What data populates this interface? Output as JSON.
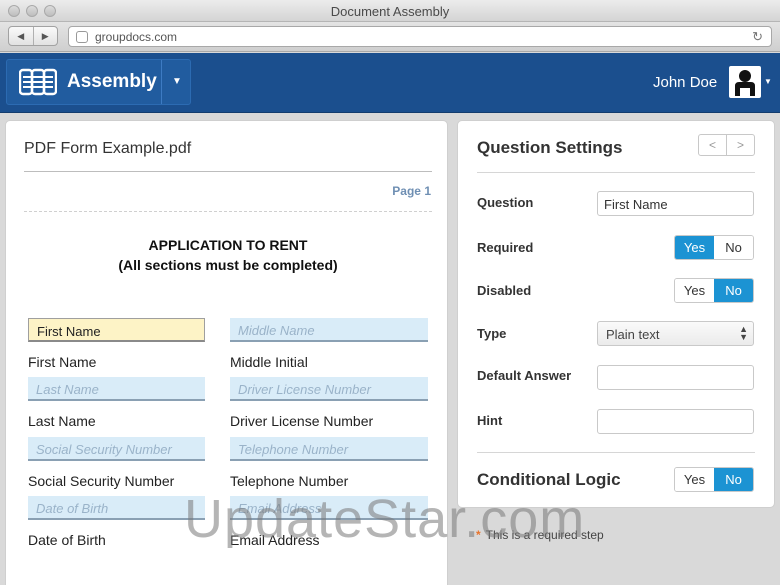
{
  "window": {
    "title": "Document Assembly"
  },
  "browser": {
    "url": "groupdocs.com",
    "back": "◀",
    "forward": "▶",
    "reload": "↻"
  },
  "app": {
    "brand": "Assembly",
    "user_name": "John Doe"
  },
  "document": {
    "file_name": "PDF Form Example.pdf",
    "page_label": "Page 1",
    "heading_line1": "APPLICATION TO RENT",
    "heading_line2": "(All sections must be completed)",
    "rows": [
      {
        "left": {
          "value": "First Name",
          "label": "First Name"
        },
        "right": {
          "placeholder": "Middle Name",
          "label": "Middle Initial"
        }
      },
      {
        "left": {
          "placeholder": "Last Name",
          "label": "Last Name"
        },
        "right": {
          "placeholder": "Driver License Number",
          "label": "Driver License Number"
        }
      },
      {
        "left": {
          "placeholder": "Social Security Number",
          "label": "Social Security Number"
        },
        "right": {
          "placeholder": "Telephone Number",
          "label": "Telephone Number"
        }
      },
      {
        "left": {
          "placeholder": "Date of Birth",
          "label": "Date of Birth"
        },
        "right": {
          "placeholder": "Email Address",
          "label": "Email Address"
        }
      }
    ]
  },
  "settings": {
    "title": "Question Settings",
    "prev": "<",
    "next": ">",
    "question_label": "Question",
    "question_value": "First Name",
    "required_label": "Required",
    "disabled_label": "Disabled",
    "yes": "Yes",
    "no": "No",
    "type_label": "Type",
    "type_value": "Plain text",
    "default_answer_label": "Default Answer",
    "default_answer_value": "",
    "hint_label": "Hint",
    "hint_value": "",
    "conditional_logic_label": "Conditional Logic",
    "required_note": "This is a required step",
    "required_star": "*"
  },
  "watermark": "UpdateStar.com",
  "colors": {
    "header": "#1b4f8e",
    "toggle_on": "#1c93d3",
    "active_field": "#fdf3c6",
    "field": "#d9ecf8"
  }
}
